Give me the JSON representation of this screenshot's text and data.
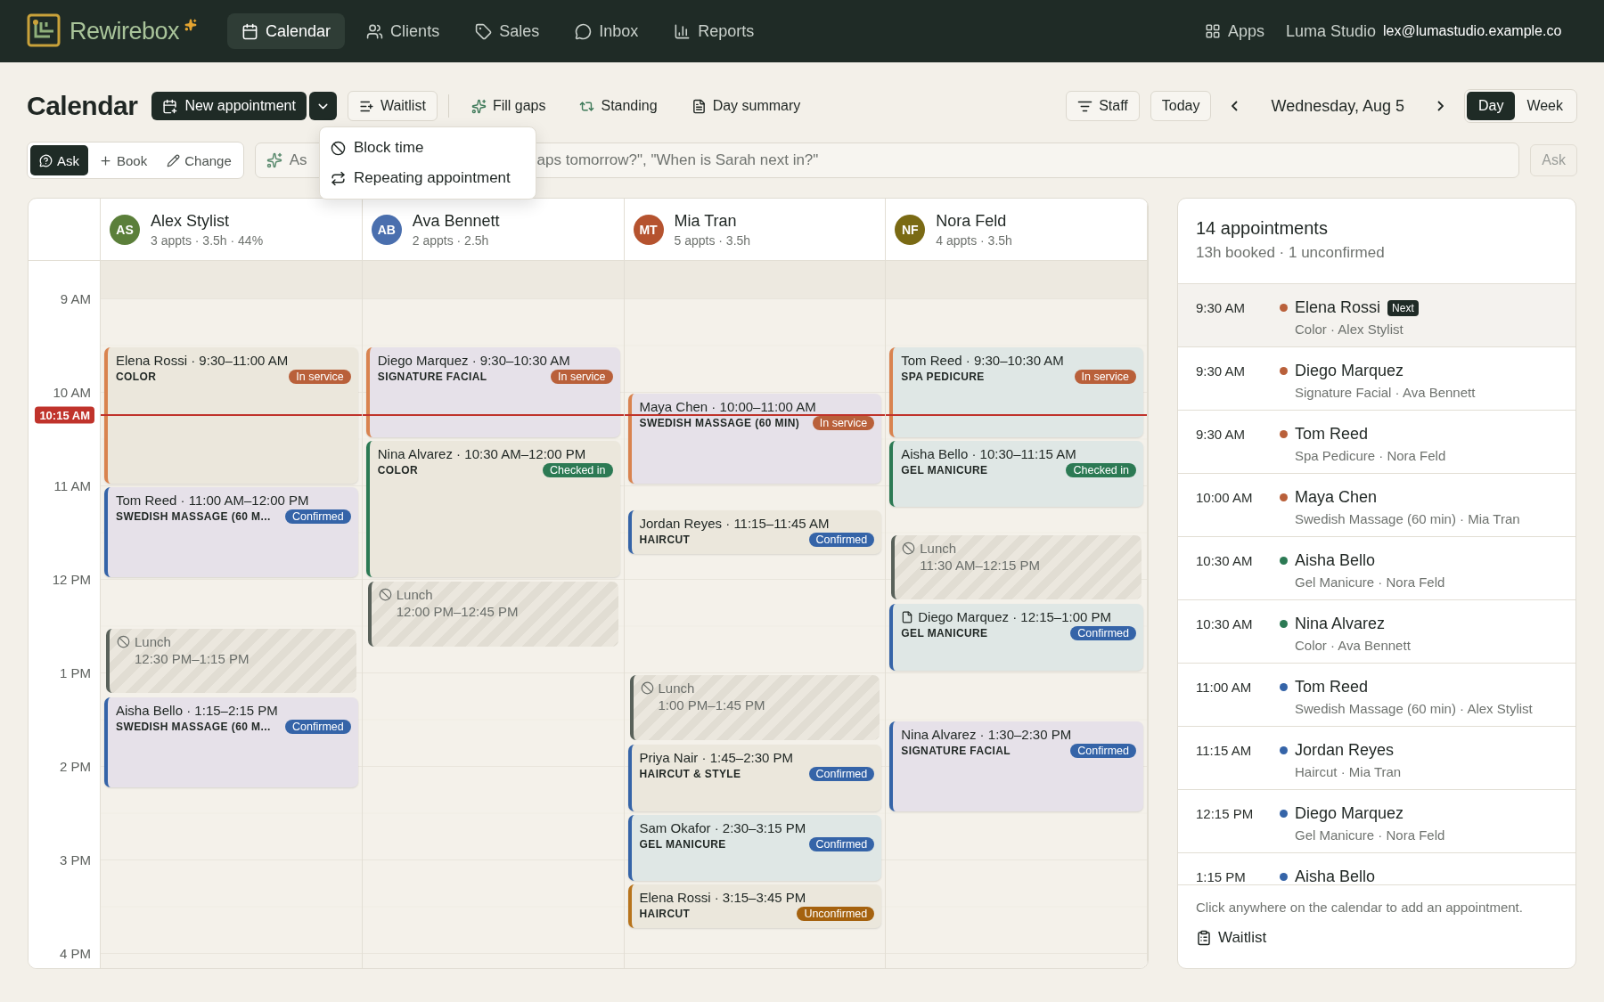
{
  "topbar": {
    "brand": "Rewirebox",
    "nav": [
      {
        "label": "Calendar",
        "selected": true
      },
      {
        "label": "Clients",
        "selected": false
      },
      {
        "label": "Sales",
        "selected": false
      },
      {
        "label": "Inbox",
        "selected": false
      },
      {
        "label": "Reports",
        "selected": false
      }
    ],
    "apps": "Apps",
    "studio": "Luma Studio",
    "email": "lex@lumastudio.example.co"
  },
  "toolbar": {
    "title": "Calendar",
    "new_appointment": "New appointment",
    "waitlist": "Waitlist",
    "fill_gaps": "Fill gaps",
    "standing": "Standing",
    "day_summary": "Day summary",
    "staff": "Staff",
    "today": "Today",
    "date": "Wednesday, Aug 5",
    "views": [
      {
        "label": "Day",
        "selected": true
      },
      {
        "label": "Week",
        "selected": false
      }
    ]
  },
  "dropdown": {
    "items": [
      "Block time",
      "Repeating appointment"
    ]
  },
  "ask_bar": {
    "modes": [
      {
        "label": "Ask",
        "selected": true
      },
      {
        "label": "Book",
        "selected": false
      },
      {
        "label": "Change",
        "selected": false
      }
    ],
    "placeholder_start": "As",
    "placeholder_end": "aps tomorrow?\", \"When is Sarah next in?\"",
    "submit": {
      "label": "Ask",
      "disabled": true
    }
  },
  "time_labels": [
    "9 AM",
    "10 AM",
    "11 AM",
    "12 PM",
    "1 PM",
    "2 PM",
    "3 PM",
    "4 PM"
  ],
  "now": "10:15 AM",
  "staff": [
    {
      "initials": "AS",
      "name": "Alex Stylist",
      "summary": "3 appts · 3.5h · 44%",
      "color": "#5b7f3a",
      "events": [
        {
          "kind": "appointment",
          "title": "Elena Rossi · 9:30–11:00 AM",
          "service": "COLOR",
          "status": {
            "label": "In service",
            "kind": "in-service"
          },
          "color": "#ebe7dc"
        },
        {
          "kind": "appointment",
          "title": "Tom Reed · 11:00 AM–12:00 PM",
          "service": "SWEDISH MASSAGE (60 M...",
          "status": {
            "label": "Confirmed",
            "kind": "confirmed"
          },
          "color": "#e6e1e9"
        },
        {
          "kind": "block",
          "label": "Lunch",
          "time": "12:30 PM–1:15 PM"
        },
        {
          "kind": "appointment",
          "title": "Aisha Bello · 1:15–2:15 PM",
          "service": "SWEDISH MASSAGE (60 M...",
          "status": {
            "label": "Confirmed",
            "kind": "confirmed"
          },
          "color": "#e6e1e9"
        }
      ]
    },
    {
      "initials": "AB",
      "name": "Ava Bennett",
      "summary": "2 appts · 2.5h",
      "color": "#4a6fae",
      "events": [
        {
          "kind": "appointment",
          "title": "Diego Marquez · 9:30–10:30 AM",
          "service": "SIGNATURE FACIAL",
          "status": {
            "label": "In service",
            "kind": "in-service"
          },
          "color": "#e6e1e9"
        },
        {
          "kind": "appointment",
          "title": "Nina Alvarez · 10:30 AM–12:00 PM",
          "service": "COLOR",
          "status": {
            "label": "Checked in",
            "kind": "checked-in"
          },
          "color": "#ebe7dc"
        },
        {
          "kind": "block",
          "label": "Lunch",
          "time": "12:00 PM–12:45 PM"
        }
      ]
    },
    {
      "initials": "MT",
      "name": "Mia Tran",
      "summary": "5 appts · 3.5h",
      "color": "#b5532f",
      "events": [
        {
          "kind": "appointment",
          "title": "Maya Chen · 10:00–11:00 AM",
          "service": "SWEDISH MASSAGE (60 MIN)",
          "status": {
            "label": "In service",
            "kind": "in-service"
          },
          "color": "#e6e1e9"
        },
        {
          "kind": "appointment",
          "title": "Jordan Reyes · 11:15–11:45 AM",
          "service": "HAIRCUT",
          "status": {
            "label": "Confirmed",
            "kind": "confirmed"
          },
          "color": "#ebe7dc"
        },
        {
          "kind": "block",
          "label": "Lunch",
          "time": "1:00 PM–1:45 PM"
        },
        {
          "kind": "appointment",
          "title": "Priya Nair · 1:45–2:30 PM",
          "service": "HAIRCUT & STYLE",
          "status": {
            "label": "Confirmed",
            "kind": "confirmed"
          },
          "color": "#ebe7dc"
        },
        {
          "kind": "appointment",
          "title": "Sam Okafor · 2:30–3:15 PM",
          "service": "GEL MANICURE",
          "status": {
            "label": "Confirmed",
            "kind": "confirmed"
          },
          "color": "#dfe7e5"
        },
        {
          "kind": "appointment",
          "title": "Elena Rossi · 3:15–3:45 PM",
          "service": "HAIRCUT",
          "status": {
            "label": "Unconfirmed",
            "kind": "unconfirmed"
          },
          "color": "#ebe7dc"
        }
      ]
    },
    {
      "initials": "NF",
      "name": "Nora Feld",
      "summary": "4 appts · 3.5h",
      "color": "#7a6a14",
      "events": [
        {
          "kind": "appointment",
          "title": "Tom Reed · 9:30–10:30 AM",
          "service": "SPA PEDICURE",
          "status": {
            "label": "In service",
            "kind": "in-service"
          },
          "color": "#dfe7e5"
        },
        {
          "kind": "appointment",
          "title": "Aisha Bello · 10:30–11:15 AM",
          "service": "GEL MANICURE",
          "status": {
            "label": "Checked in",
            "kind": "checked-in"
          },
          "color": "#dfe7e5"
        },
        {
          "kind": "block",
          "label": "Lunch",
          "time": "11:30 AM–12:15 PM"
        },
        {
          "kind": "appointment",
          "title": "Diego Marquez · 12:15–1:00 PM",
          "service": "GEL MANICURE",
          "status": {
            "label": "Confirmed",
            "kind": "confirmed"
          },
          "color": "#dfe7e5",
          "note": true
        },
        {
          "kind": "appointment",
          "title": "Nina Alvarez · 1:30–2:30 PM",
          "service": "SIGNATURE FACIAL",
          "status": {
            "label": "Confirmed",
            "kind": "confirmed"
          },
          "color": "#e6e1e9"
        }
      ]
    }
  ],
  "panel": {
    "title": "14 appointments",
    "subtitle": "13h booked · 1 unconfirmed",
    "rows": [
      {
        "time": "9:30 AM",
        "name": "Elena Rossi",
        "badge": "Next",
        "detail": "Color · Alex Stylist",
        "color": "#b9603a",
        "selected": true
      },
      {
        "time": "9:30 AM",
        "name": "Diego Marquez",
        "detail": "Signature Facial · Ava Bennett",
        "color": "#b9603a",
        "selected": false
      },
      {
        "time": "9:30 AM",
        "name": "Tom Reed",
        "detail": "Spa Pedicure · Nora Feld",
        "color": "#b9603a",
        "selected": false
      },
      {
        "time": "10:00 AM",
        "name": "Maya Chen",
        "detail": "Swedish Massage (60 min) · Mia Tran",
        "color": "#b9603a",
        "selected": false
      },
      {
        "time": "10:30 AM",
        "name": "Aisha Bello",
        "detail": "Gel Manicure · Nora Feld",
        "color": "#2c7a54",
        "selected": false
      },
      {
        "time": "10:30 AM",
        "name": "Nina Alvarez",
        "detail": "Color · Ava Bennett",
        "color": "#2c7a54",
        "selected": false
      },
      {
        "time": "11:00 AM",
        "name": "Tom Reed",
        "detail": "Swedish Massage (60 min) · Alex Stylist",
        "color": "#3564a8",
        "selected": false
      },
      {
        "time": "11:15 AM",
        "name": "Jordan Reyes",
        "detail": "Haircut · Mia Tran",
        "color": "#3564a8",
        "selected": false
      },
      {
        "time": "12:15 PM",
        "name": "Diego Marquez",
        "detail": "Gel Manicure · Nora Feld",
        "color": "#3564a8",
        "selected": false
      },
      {
        "time": "1:15 PM",
        "name": "Aisha Bello",
        "color": "#3564a8",
        "selected": false
      }
    ],
    "hint": "Click anywhere on the calendar to add an appointment.",
    "waitlist": "Waitlist"
  }
}
